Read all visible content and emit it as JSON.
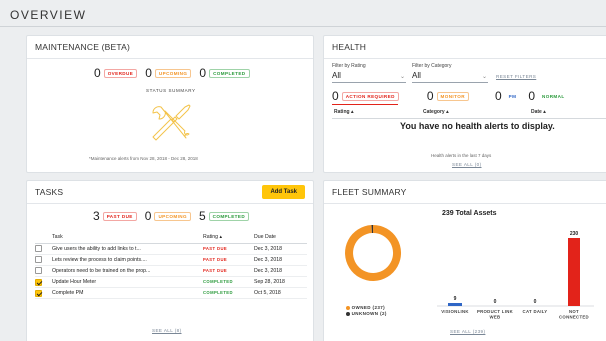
{
  "page": {
    "title": "OVERVIEW"
  },
  "maintenance": {
    "title": "MAINTENANCE (BETA)",
    "overdue_count": "0",
    "overdue_label": "OVERDUE",
    "upcoming_count": "0",
    "upcoming_label": "UPCOMING",
    "completed_count": "0",
    "completed_label": "COMPLETED",
    "summary_label": "STATUS SUMMARY",
    "footnote": "*Maintenance alerts from Nov 28, 2018 - Dec 28, 2018"
  },
  "health": {
    "title": "HEALTH",
    "filter_rating_label": "Filter by Rating",
    "filter_rating_value": "All",
    "filter_category_label": "Filter by Category",
    "filter_category_value": "All",
    "reset_label": "RESET FILTERS",
    "action_count": "0",
    "action_label": "ACTION REQUIRED",
    "monitor_count": "0",
    "monitor_label": "MONITOR",
    "pm_count": "0",
    "pm_label": "PM",
    "normal_count": "0",
    "normal_label": "NORMAL",
    "col_rating": "Rating",
    "col_category": "Category",
    "col_date": "Date",
    "empty_message": "You have no health alerts to display.",
    "footnote": "Health alerts in the last 7 days",
    "see_all": "SEE ALL (0)"
  },
  "tasks": {
    "title": "TASKS",
    "add_label": "Add Task",
    "pastdue_count": "3",
    "pastdue_label": "PAST DUE",
    "upcoming_count": "0",
    "upcoming_label": "UPCOMING",
    "completed_count": "5",
    "completed_label": "COMPLETED",
    "col_task": "Task",
    "col_rating": "Rating",
    "col_due": "Due Date",
    "rows": [
      {
        "name": "Give users the ability to add links to t...",
        "status": "PAST DUE",
        "due": "Dec 3, 2018",
        "checked": false
      },
      {
        "name": "Lets review the process to claim points....",
        "status": "PAST DUE",
        "due": "Dec 3, 2018",
        "checked": false
      },
      {
        "name": "Operators need to be trained on the prop...",
        "status": "PAST DUE",
        "due": "Dec 3, 2018",
        "checked": false
      },
      {
        "name": "Update Hour Meter",
        "status": "COMPLETED",
        "due": "Sep 28, 2018",
        "checked": true
      },
      {
        "name": "Complete PM",
        "status": "COMPLETED",
        "due": "Oct 5, 2018",
        "checked": true
      }
    ],
    "see_all": "SEE ALL (8)"
  },
  "fleet": {
    "title": "FLEET SUMMARY",
    "total_label": "239 Total Assets",
    "legend_owned": "OWNED (237)",
    "legend_unknown": "UNKNOWN (2)",
    "see_all": "SEE ALL (239)"
  },
  "colors": {
    "accent": "#ffc50a",
    "pie_owned": "#f39425",
    "pie_unknown": "#333333",
    "bar_visionlink": "#2f66c6",
    "bar_not_connected": "#e2231a"
  },
  "chart_data": [
    {
      "type": "pie",
      "labels": [
        "OWNED (237)",
        "UNKNOWN (2)"
      ],
      "values": [
        237,
        2
      ],
      "colors": [
        "#f39425",
        "#333333"
      ],
      "legend": "bottom"
    },
    {
      "type": "bar",
      "categories": [
        "VISIONLINK",
        "PRODUCT LINK WEB",
        "CAT DAILY",
        "NOT CONNECTED"
      ],
      "values": [
        9,
        0,
        0,
        230
      ],
      "colors": [
        "#2f66c6",
        "#2f66c6",
        "#2f66c6",
        "#e2231a"
      ],
      "ylim": [
        0,
        230
      ],
      "grid": false
    }
  ]
}
